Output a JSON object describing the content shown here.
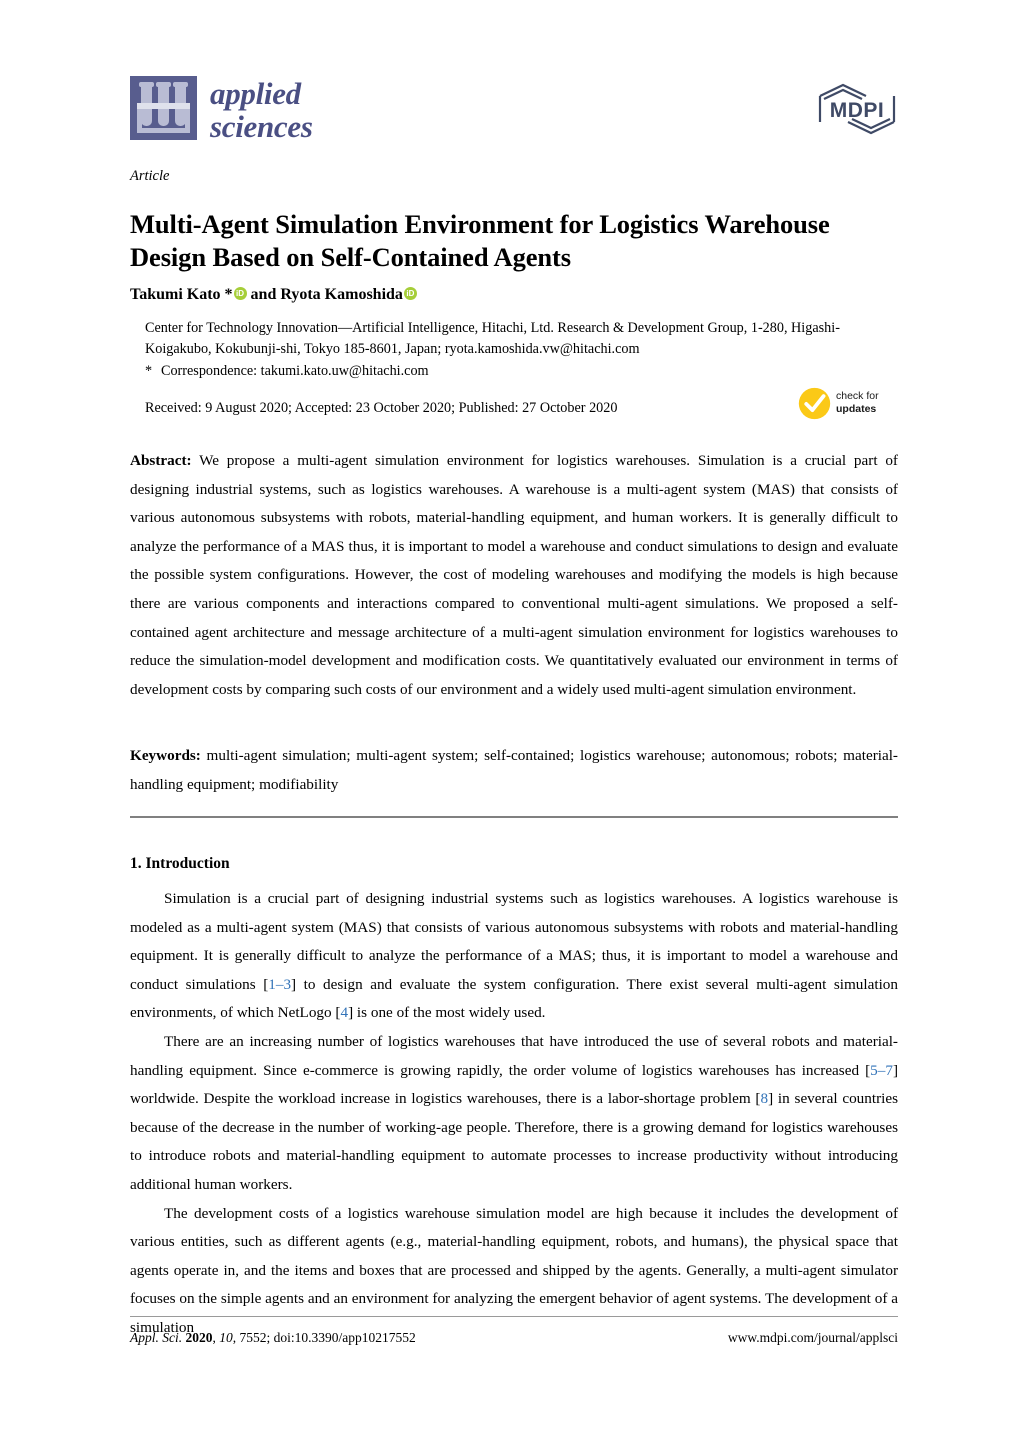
{
  "journal": {
    "name_line1": "applied",
    "name_line2": "sciences",
    "publisher_logo_text": "MDPI",
    "logo_icon": "test-tube-rack-icon"
  },
  "article": {
    "type": "Article",
    "title": "Multi-Agent Simulation Environment for Logistics Warehouse Design Based on Self-Contained Agents",
    "authors": "Takumi Kato *",
    "authors_join": " and ",
    "authors_second": "Ryota Kamoshida",
    "orcid_label": "iD",
    "affiliation": "Center for Technology Innovation—Artificial Intelligence, Hitachi, Ltd. Research & Development Group, 1-280, Higashi-Koigakubo, Kokubunji-shi, Tokyo 185-8601, Japan; ryota.kamoshida.vw@hitachi.com",
    "correspondence_marker": "*",
    "correspondence": "Correspondence: takumi.kato.uw@hitachi.com",
    "dates": "Received: 9 August 2020; Accepted: 23 October 2020; Published: 27 October 2020"
  },
  "check_updates": {
    "line1": "check for",
    "line2": "updates",
    "icon": "check-circle-icon",
    "color": "#fbc917"
  },
  "abstract": {
    "label": "Abstract:",
    "text": " We propose a multi-agent simulation environment for logistics warehouses. Simulation is a crucial part of designing industrial systems, such as logistics warehouses. A warehouse is a multi-agent system (MAS) that consists of various autonomous subsystems with robots, material-handling equipment, and human workers. It is generally difficult to analyze the performance of a MAS thus, it is important to model a warehouse and conduct simulations to design and evaluate the possible system configurations. However, the cost of modeling warehouses and modifying the models is high because there are various components and interactions compared to conventional multi-agent simulations. We proposed a self-contained agent architecture and message architecture of a multi-agent simulation environment for logistics warehouses to reduce the simulation-model development and modification costs. We quantitatively evaluated our environment in terms of development costs by comparing such costs of our environment and a widely used multi-agent simulation environment."
  },
  "keywords": {
    "label": "Keywords:",
    "text": "  multi-agent simulation; multi-agent system; self-contained; logistics warehouse; autonomous; robots; material-handling equipment; modifiability"
  },
  "introduction": {
    "heading": "1. Introduction",
    "p1_a": "Simulation is a crucial part of designing industrial systems such as logistics warehouses. A logistics warehouse is modeled as a multi-agent system (MAS) that consists of various autonomous subsystems with robots and material-handling equipment. It is generally difficult to analyze the performance of a MAS; thus, it is important to model a warehouse and conduct simulations [",
    "p1_cite1": "1–3",
    "p1_b": "] to design and evaluate the system configuration. There exist several multi-agent simulation environments, of which NetLogo [",
    "p1_cite2": "4",
    "p1_c": "] is one of the most widely used.",
    "p2_a": "There are an increasing number of logistics warehouses that have introduced the use of several robots and material-handling equipment. Since e-commerce is growing rapidly, the order volume of logistics warehouses has increased [",
    "p2_cite1": "5–7",
    "p2_b": "] worldwide. Despite the workload increase in logistics warehouses, there is a labor-shortage problem [",
    "p2_cite2": "8",
    "p2_c": "] in several countries because of the decrease in the number of working-age people. Therefore, there is a growing demand for logistics warehouses to introduce robots and material-handling equipment to automate processes to increase productivity without introducing additional human workers.",
    "p3": "The development costs of a logistics warehouse simulation model are high because it includes the development of various entities, such as different agents (e.g., material-handling equipment, robots, and humans), the physical space that agents operate in, and the items and boxes that are processed and shipped by the agents. Generally, a multi-agent simulator focuses on the simple agents and an environment for analyzing the emergent behavior of agent systems. The development of a simulation"
  },
  "footer": {
    "journal_abbrev": "Appl. Sci.",
    "year": "2020",
    "volume": "10",
    "article_id": "7552",
    "doi": "doi:10.3390/app10217552",
    "url": "www.mdpi.com/journal/applsci"
  },
  "colors": {
    "logo_purple": "#585d8e",
    "mdpi_navy": "#3f4a66",
    "orcid_green": "#a6ce39",
    "citation_blue": "#3273b8",
    "check_yellow": "#fbc917"
  }
}
